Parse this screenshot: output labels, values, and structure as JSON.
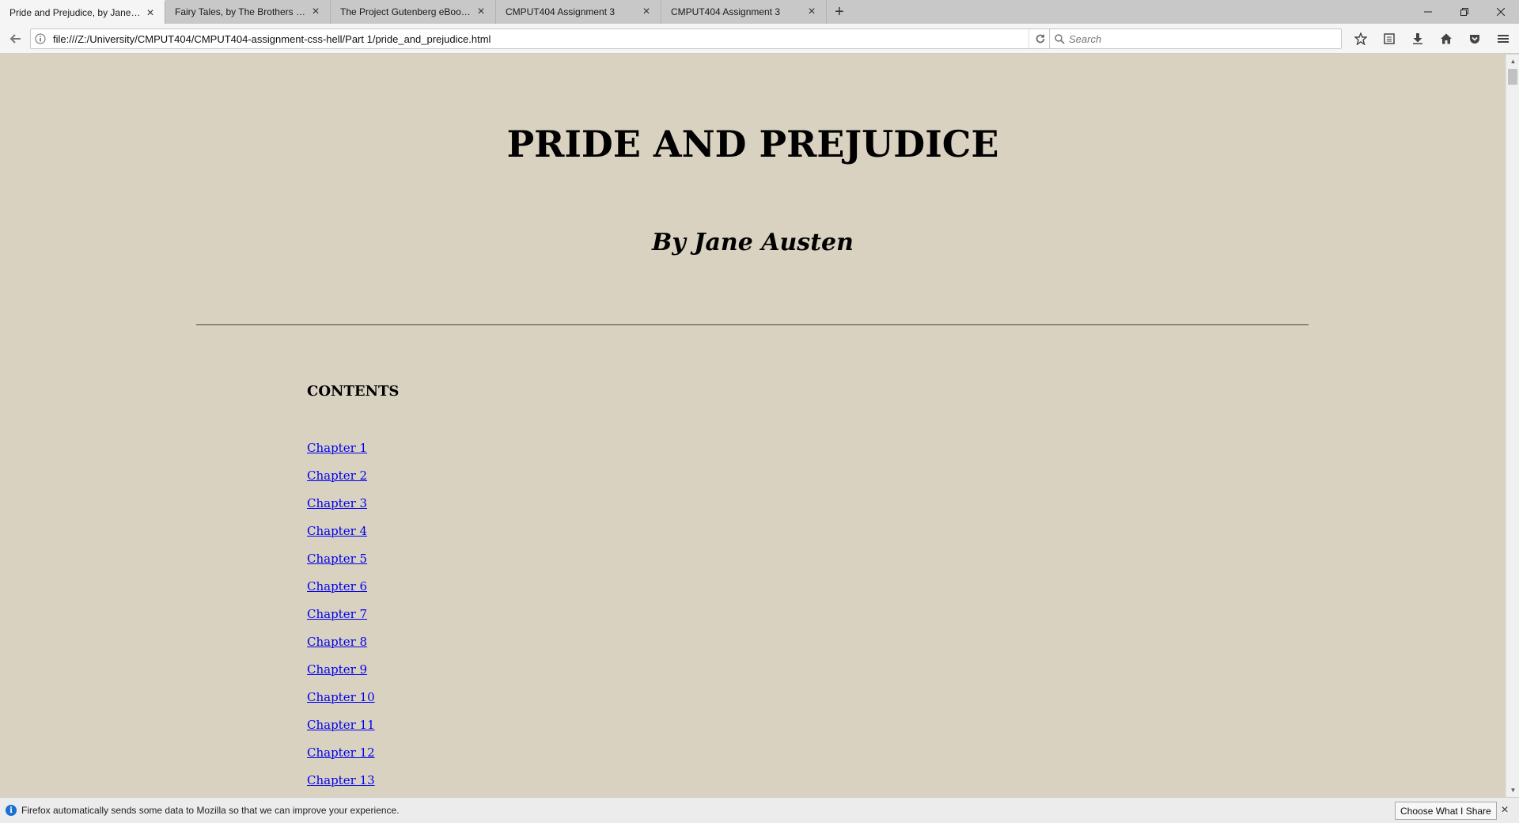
{
  "browser": {
    "tabs": [
      {
        "label": "Pride and Prejudice, by Jane A...",
        "active": true
      },
      {
        "label": "Fairy Tales, by The Brothers Gr...",
        "active": false
      },
      {
        "label": "The Project Gutenberg eBook ...",
        "active": false
      },
      {
        "label": "CMPUT404 Assignment 3",
        "active": false
      },
      {
        "label": "CMPUT404 Assignment 3",
        "active": false
      }
    ],
    "url": "file:///Z:/University/CMPUT404/CMPUT404-assignment-css-hell/Part 1/pride_and_prejudice.html",
    "search_placeholder": "Search"
  },
  "page": {
    "title": "PRIDE AND PREJUDICE",
    "author": "By Jane Austen",
    "contents_heading": "CONTENTS",
    "chapters": [
      "Chapter 1",
      "Chapter 2",
      "Chapter 3",
      "Chapter 4",
      "Chapter 5",
      "Chapter 6",
      "Chapter 7",
      "Chapter 8",
      "Chapter 9",
      "Chapter 10",
      "Chapter 11",
      "Chapter 12",
      "Chapter 13"
    ],
    "background_color": "#d9d2c0",
    "link_color": "#0000ee"
  },
  "notification": {
    "message": "Firefox automatically sends some data to Mozilla so that we can improve your experience.",
    "button": "Choose What I Share",
    "info_icon": "i"
  }
}
